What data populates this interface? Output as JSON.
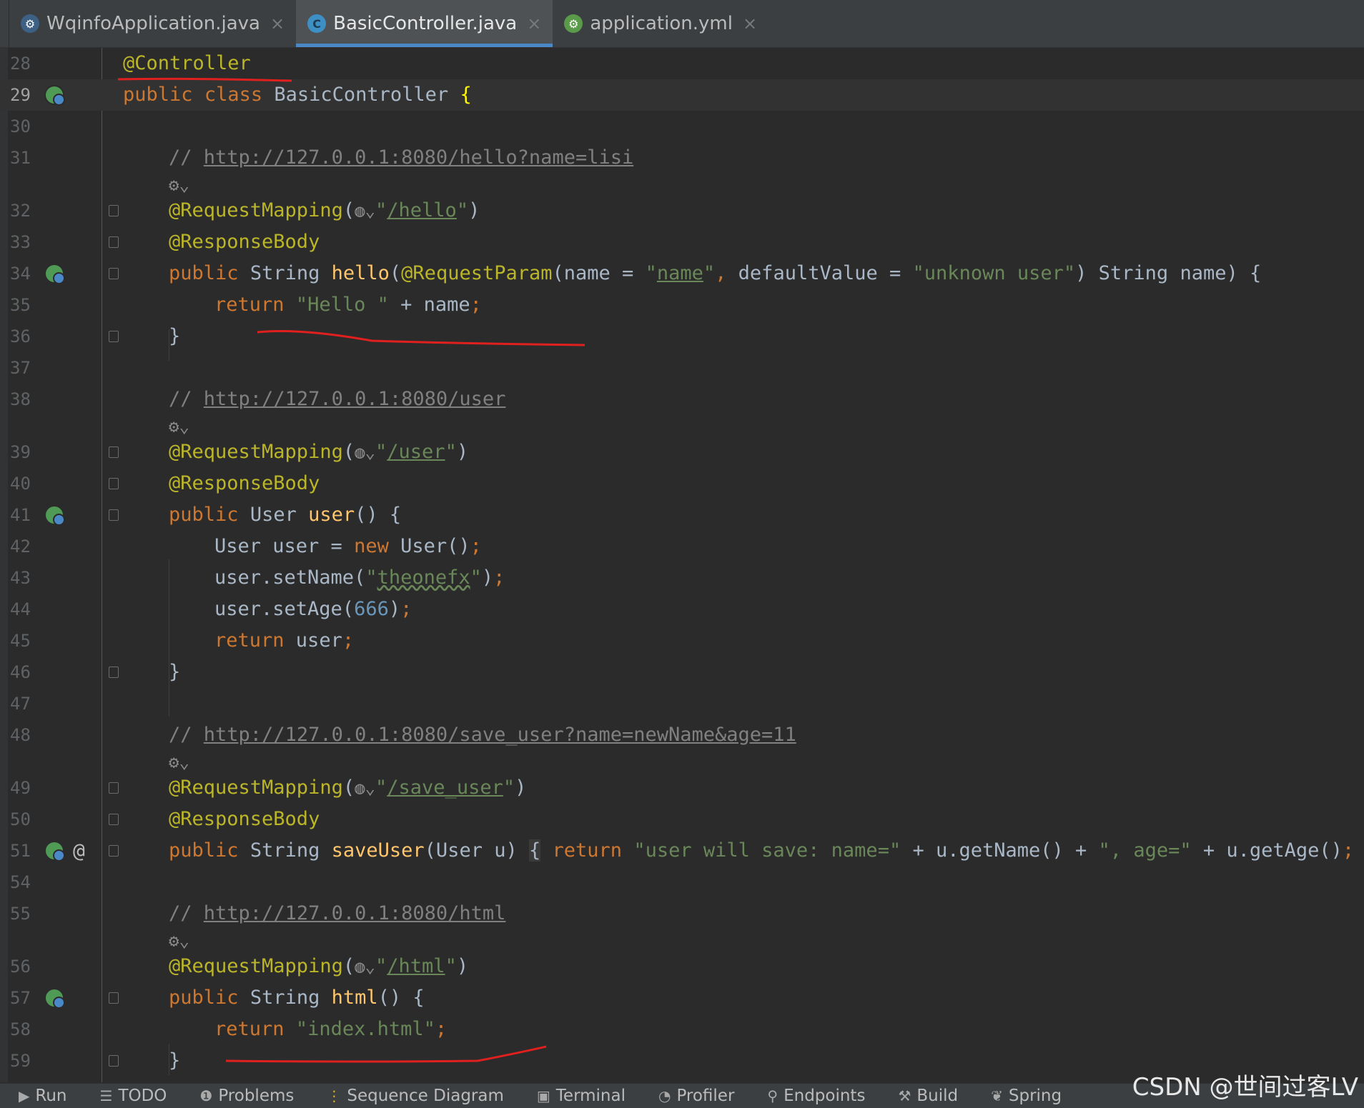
{
  "tabs": [
    {
      "label": "WqinfoApplication.java",
      "icon": "spring-boot-class-icon",
      "active": false
    },
    {
      "label": "BasicController.java",
      "icon": "java-class-icon",
      "active": true
    },
    {
      "label": "application.yml",
      "icon": "spring-yaml-icon",
      "active": false
    }
  ],
  "tab_close_glyph": "×",
  "editor": {
    "lines": [
      {
        "num": "28"
      },
      {
        "num": "29"
      },
      {
        "num": "30"
      },
      {
        "num": "31"
      },
      {
        "num": ""
      },
      {
        "num": "32"
      },
      {
        "num": "33"
      },
      {
        "num": "34"
      },
      {
        "num": "35"
      },
      {
        "num": "36"
      },
      {
        "num": "37"
      },
      {
        "num": "38"
      },
      {
        "num": ""
      },
      {
        "num": "39"
      },
      {
        "num": "40"
      },
      {
        "num": "41"
      },
      {
        "num": "42"
      },
      {
        "num": "43"
      },
      {
        "num": "44"
      },
      {
        "num": "45"
      },
      {
        "num": "46"
      },
      {
        "num": "47"
      },
      {
        "num": "48"
      },
      {
        "num": ""
      },
      {
        "num": "49"
      },
      {
        "num": "50"
      },
      {
        "num": "51"
      },
      {
        "num": "54"
      },
      {
        "num": "55"
      },
      {
        "num": ""
      },
      {
        "num": "56"
      },
      {
        "num": "57"
      },
      {
        "num": "58"
      },
      {
        "num": "59"
      }
    ],
    "code": {
      "controller_annotation": "@Controller",
      "kw_public": "public",
      "kw_class": "class",
      "kw_return": "return",
      "kw_new": "new",
      "class_name": "BasicController",
      "open_brace": "{",
      "close_brace": "}",
      "comment_prefix": "// ",
      "url_hello": "http://127.0.0.1:8080/hello?name=lisi",
      "url_user": "http://127.0.0.1:8080/user",
      "url_save_user": "http://127.0.0.1:8080/save_user?name=newName&age=11",
      "url_html": "http://127.0.0.1:8080/html",
      "request_mapping": "@RequestMapping",
      "response_body": "@ResponseBody",
      "request_param": "@RequestParam",
      "path_hello": "/hello",
      "path_user": "/user",
      "path_save_user": "/save_user",
      "path_html": "/html",
      "type_string": "String",
      "type_user": "User",
      "method_hello": "hello",
      "method_user": "user",
      "method_save_user": "saveUser",
      "method_html": "html",
      "param_name_key": "name",
      "param_name_value": "name",
      "default_value_key": "defaultValue",
      "default_value": "unknown user",
      "param_tail": ") String name) {",
      "hello_str": "\"Hello \"",
      "hello_tail": " + name",
      "user_decl": "User user = ",
      "user_ctor": " User()",
      "set_name_call": "user.setName(",
      "set_name_value": "theonefx",
      "set_age_call": "user.setAge(",
      "set_age_value": "666",
      "return_user": " user",
      "save_params": "(User u) ",
      "save_str1": "\"user will save: name=\"",
      "save_mid": " + u.getName() + ",
      "save_str2": "\", age=\"",
      "save_tail": " + u.getAge()",
      "html_return": "\"index.html\"",
      "semicolon": ";",
      "empty_parens": "() {",
      "inlay_hint": "⚙⌄"
    }
  },
  "toolbar": [
    {
      "label": "Run",
      "icon": "run-icon",
      "glyph": "▶"
    },
    {
      "label": "TODO",
      "icon": "todo-icon",
      "glyph": "☰"
    },
    {
      "label": "Problems",
      "icon": "problems-icon",
      "glyph": "❶"
    },
    {
      "label": "Sequence Diagram",
      "icon": "sequence-diagram-icon",
      "glyph": "⋮"
    },
    {
      "label": "Terminal",
      "icon": "terminal-icon",
      "glyph": "▣"
    },
    {
      "label": "Profiler",
      "icon": "profiler-icon",
      "glyph": "◔"
    },
    {
      "label": "Endpoints",
      "icon": "endpoints-icon",
      "glyph": "⚲"
    },
    {
      "label": "Build",
      "icon": "build-icon",
      "glyph": "⚒"
    },
    {
      "label": "Spring",
      "icon": "spring-icon",
      "glyph": "❦"
    }
  ],
  "watermark": "CSDN @世间过客LV",
  "colors": {
    "background": "#2b2b2b",
    "keyword": "#cc7832",
    "annotation": "#bbb529",
    "string": "#6a8759",
    "comment": "#808080",
    "method": "#ffc66d",
    "number": "#6897bb",
    "active_tab_underline": "#4a88c7",
    "red_marks": "#e0201e"
  }
}
